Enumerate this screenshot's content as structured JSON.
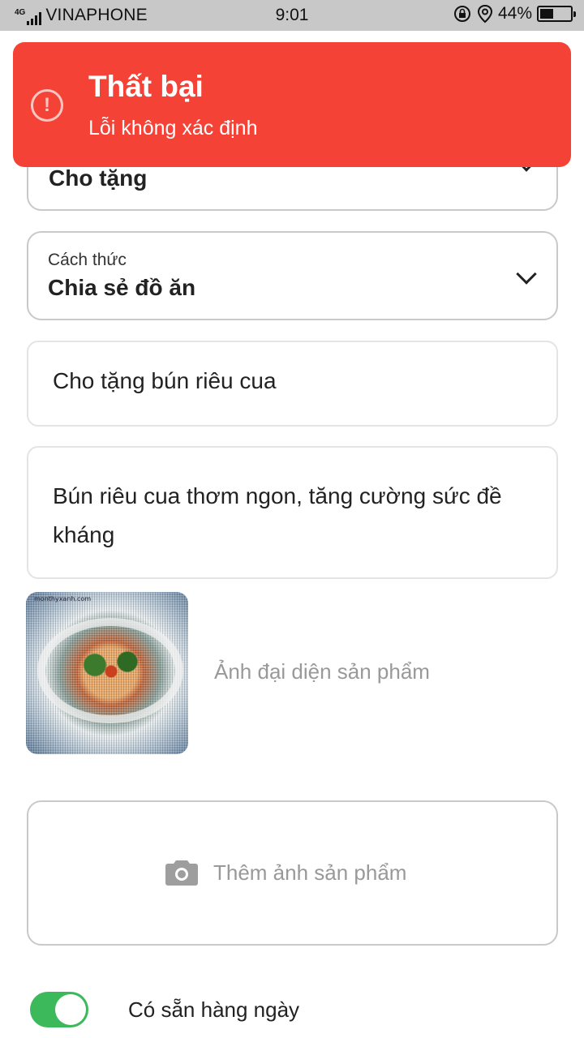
{
  "status_bar": {
    "network": "4G",
    "carrier": "VINAPHONE",
    "time": "9:01",
    "battery": "44%",
    "battery_level": 0.44
  },
  "form": {
    "type_value": "Cho tặng",
    "method_label": "Cách thức",
    "method_value": "Chia sẻ đồ ăn",
    "title_value": "Cho tặng bún riêu cua",
    "description_value": "Bún riêu cua thơm ngon, tăng cường sức đề kháng"
  },
  "avatar": {
    "label": "Ảnh đại diện sản phẩm",
    "watermark": "monthyxanh.com"
  },
  "add_photo": {
    "icon": "camera-icon",
    "label": "Thêm ảnh sản phẩm"
  },
  "availability": {
    "label": "Có sẵn hàng ngày",
    "enabled": true
  },
  "toast": {
    "icon": "alert-circle-icon",
    "title": "Thất bại",
    "message": "Lỗi không xác định",
    "color": "#f44336"
  }
}
